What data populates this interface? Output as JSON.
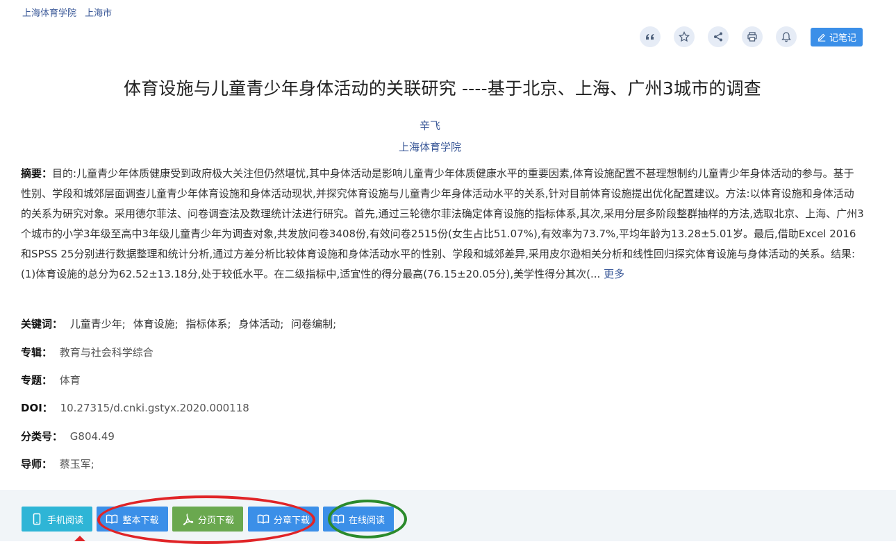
{
  "breadcrumb": {
    "school": "上海体育学院",
    "city": "上海市"
  },
  "toolbar": {
    "note_label": "记笔记"
  },
  "title": "体育设施与儿童青少年身体活动的关联研究 ----基于北京、上海、广州3城市的调查",
  "author": "辛飞",
  "organization": "上海体育学院",
  "abstract": {
    "label": "摘要：",
    "text": "目的:儿童青少年体质健康受到政府极大关注但仍然堪忧,其中身体活动是影响儿童青少年体质健康水平的重要因素,体育设施配置不甚理想制约儿童青少年身体活动的参与。基于性别、学段和城郊层面调查儿童青少年体育设施和身体活动现状,并探究体育设施与儿童青少年身体活动水平的关系,针对目前体育设施提出优化配置建议。方法:以体育设施和身体活动的关系为研究对象。采用德尔菲法、问卷调查法及数理统计法进行研究。首先,通过三轮德尔菲法确定体育设施的指标体系,其次,采用分层多阶段整群抽样的方法,选取北京、上海、广州3个城市的小学3年级至高中3年级儿童青少年为调查对象,共发放问卷3408份,有效问卷2515份(女生占比51.07%),有效率为73.7%,平均年龄为13.28±5.01岁。最后,借助Excel 2016和SPSS 25分别进行数据整理和统计分析,通过方差分析比较体育设施和身体活动水平的性别、学段和城郊差异,采用皮尔逊相关分析和线性回归探究体育设施与身体活动的关系。结果:(1)体育设施的总分为62.52±13.18分,处于较低水平。在二级指标中,适宜性的得分最高(76.15±20.05分),美学性得分其次(...",
    "more": "更多"
  },
  "keywords": {
    "label": "关键词：",
    "items": [
      "儿童青少年;",
      "体育设施;",
      "指标体系;",
      "身体活动;",
      "问卷编制;"
    ]
  },
  "series": {
    "label": "专辑：",
    "value": "教育与社会科学综合"
  },
  "topic": {
    "label": "专题：",
    "value": "体育"
  },
  "doi": {
    "label": "DOI：",
    "value": "10.27315/d.cnki.gstyx.2020.000118"
  },
  "classification": {
    "label": "分类号：",
    "value": "G804.49"
  },
  "advisor": {
    "label": "导师：",
    "value": "蔡玉军;"
  },
  "actions": {
    "mobile": "手机阅读",
    "whole": "整本下载",
    "page": "分页下载",
    "chapter": "分章下载",
    "online": "在线阅读"
  },
  "colors": {
    "link": "#3b5998",
    "primary_button": "#3b8fe8",
    "mobile_button": "#2eb5d6",
    "page_button": "#6aa84f",
    "annotation_red": "#e02427",
    "annotation_green": "#2b8a2b"
  }
}
